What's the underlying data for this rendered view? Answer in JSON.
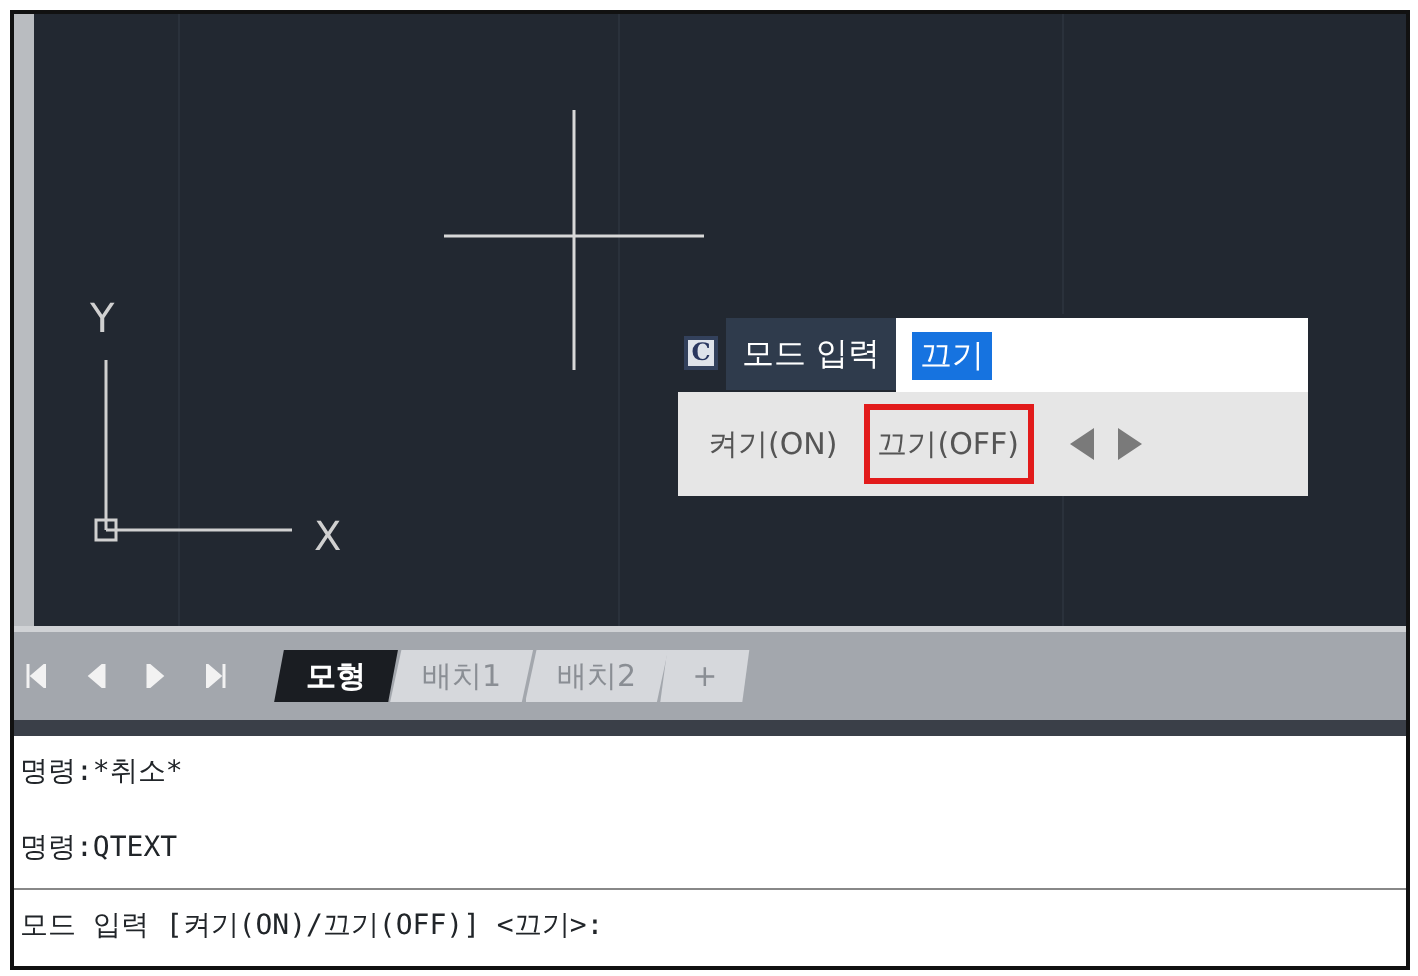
{
  "canvas": {
    "axis_labels": [
      "Y",
      "X"
    ]
  },
  "input_tooltip": {
    "badge": "C",
    "label": "모드 입력",
    "value": "끄기",
    "value_selected": true,
    "options": [
      {
        "label": "켜기(ON)",
        "selected": false
      },
      {
        "label": "끄기(OFF)",
        "selected": true
      }
    ]
  },
  "layout_tabs": [
    {
      "label": "모형",
      "selected": true
    },
    {
      "label": "배치1",
      "selected": false
    },
    {
      "label": "배치2",
      "selected": false
    },
    {
      "label": "+",
      "selected": false
    }
  ],
  "command_history": [
    "명령:*취소*",
    "명령:QTEXT"
  ],
  "command_prompt": "모드 입력 [켜기(ON)/끄기(OFF)] <끄기>:"
}
